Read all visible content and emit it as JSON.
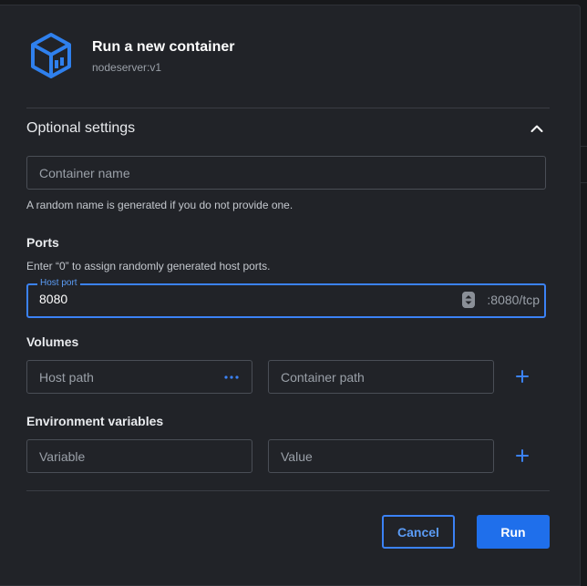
{
  "header": {
    "title": "Run a new container",
    "subtitle": "nodeserver:v1",
    "logo_icon": "container-box-icon"
  },
  "optional_settings": {
    "title": "Optional settings",
    "expanded": true,
    "toggle_icon": "chevron-up-icon"
  },
  "container_name": {
    "placeholder": "Container name",
    "value": "",
    "helper": "A random name is generated if you do not provide one."
  },
  "ports": {
    "label": "Ports",
    "helper": "Enter “0” to assign randomly generated host ports.",
    "host_port_label": "Host port",
    "host_port_value": "8080",
    "container_port": ":8080/tcp"
  },
  "volumes": {
    "label": "Volumes",
    "host_path_placeholder": "Host path",
    "container_path_placeholder": "Container path",
    "browse_icon": "more-horizontal-icon",
    "add_icon": "plus-icon"
  },
  "env": {
    "label": "Environment variables",
    "variable_placeholder": "Variable",
    "value_placeholder": "Value",
    "add_icon": "plus-icon"
  },
  "actions": {
    "cancel_label": "Cancel",
    "run_label": "Run"
  },
  "colors": {
    "accent": "#3b82f6",
    "primary_button": "#1f6feb",
    "dialog_bg": "#212328",
    "logo": "#2f80ed"
  }
}
